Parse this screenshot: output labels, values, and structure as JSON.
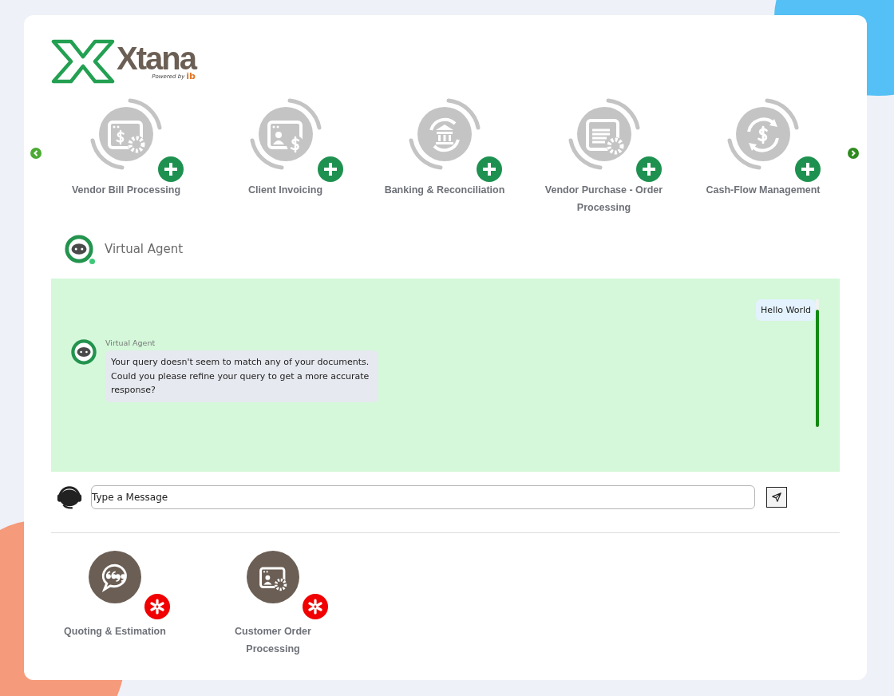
{
  "logo": {
    "name": "Xtana",
    "powered_by": "Powered by",
    "partner": "ib"
  },
  "carousel": {
    "items": [
      {
        "label": "Vendor Bill Processing",
        "kind": "bill",
        "added": false
      },
      {
        "label": "Client Invoicing",
        "kind": "invoice",
        "added": false
      },
      {
        "label": "Banking & Reconciliation",
        "kind": "bank",
        "added": false
      },
      {
        "label": "Vendor Purchase - Order Processing",
        "kind": "purchase",
        "added": false
      },
      {
        "label": "Cash-Flow Management",
        "kind": "cashflow",
        "added": false
      }
    ]
  },
  "chat": {
    "agent_name": "Virtual Agent",
    "online": true,
    "messages": [
      {
        "kind": "user",
        "text": "Hello World"
      },
      {
        "kind": "agent",
        "name": "Virtual Agent",
        "text": "Your query doesn't seem to match any of your documents. Could you please refine your query to get a more accurate response?"
      }
    ],
    "input": {
      "placeholder": "Type a Message"
    }
  },
  "modules": {
    "items": [
      {
        "label": "Quoting & Estimation",
        "kind": "quote",
        "added": true
      },
      {
        "label": "Customer Order Processing",
        "kind": "order",
        "added": true
      }
    ]
  }
}
